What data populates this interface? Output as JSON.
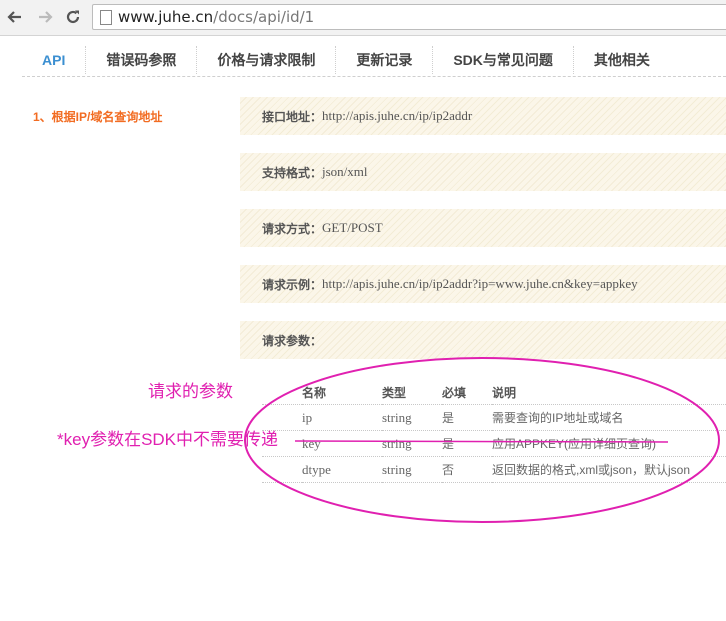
{
  "browser": {
    "url_host": "www.juhe.cn",
    "url_path": "/docs/api/id/1",
    "icons": [
      "back-arrow-icon",
      "forward-arrow-icon",
      "reload-icon",
      "page-icon"
    ]
  },
  "tabs": [
    {
      "label": "API",
      "active": true
    },
    {
      "label": "错误码参照",
      "active": false
    },
    {
      "label": "价格与请求限制",
      "active": false
    },
    {
      "label": "更新记录",
      "active": false
    },
    {
      "label": "SDK与常见问题",
      "active": false
    },
    {
      "label": "其他相关",
      "active": false
    }
  ],
  "section": {
    "title": "1、根据IP/域名查询地址"
  },
  "info": {
    "endpoint": {
      "label": "接口地址：",
      "value": "http://apis.juhe.cn/ip/ip2addr"
    },
    "format": {
      "label": "支持格式：",
      "value": "json/xml"
    },
    "method": {
      "label": "请求方式：",
      "value": "GET/POST"
    },
    "example": {
      "label": "请求示例：",
      "value": "http://apis.juhe.cn/ip/ip2addr?ip=www.juhe.cn&key=appkey"
    },
    "params": {
      "label": "请求参数："
    }
  },
  "param_table": {
    "headers": [
      "名称",
      "类型",
      "必填",
      "说明"
    ],
    "rows": [
      [
        "ip",
        "string",
        "是",
        "需要查询的IP地址或域名"
      ],
      [
        "key",
        "string",
        "是",
        "应用APPKEY(应用详细页查询)"
      ],
      [
        "dtype",
        "string",
        "否",
        "返回数据的格式,xml或json，默认json"
      ]
    ]
  },
  "annotations": {
    "params_note": "请求的参数",
    "key_note": "*key参数在SDK中不需要传递"
  },
  "colors": {
    "accent": "#3b8fd1",
    "section_title": "#f26c22",
    "annotation": "#e020b0"
  }
}
